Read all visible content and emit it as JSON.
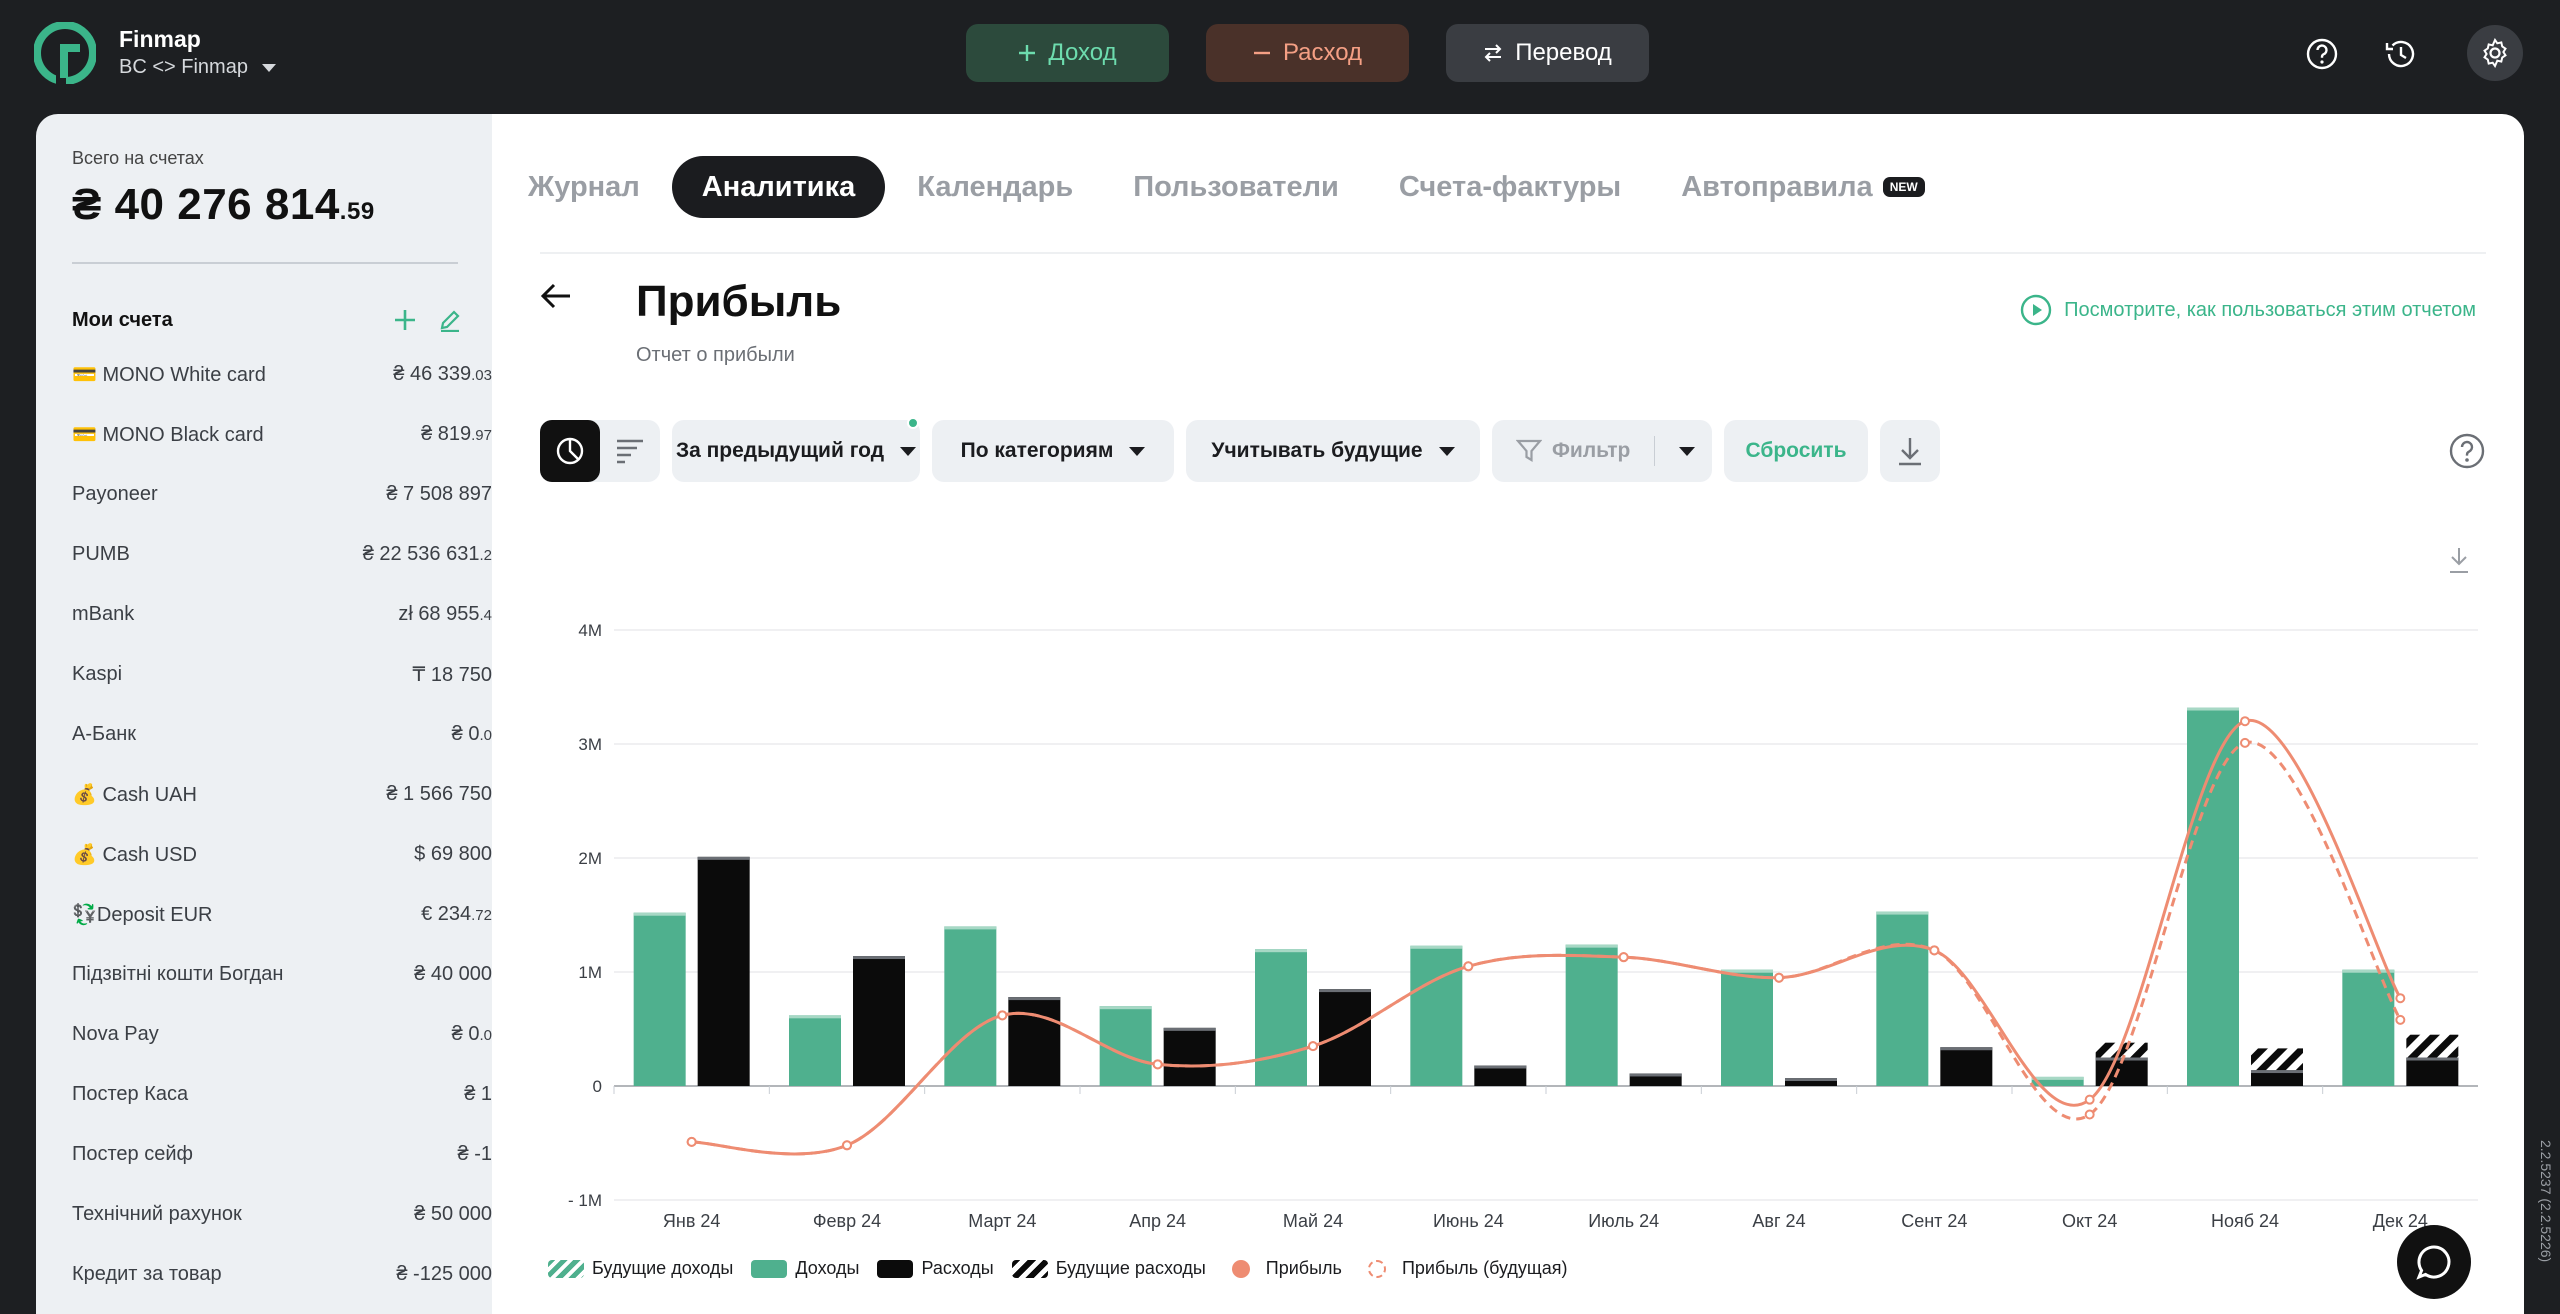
{
  "app": {
    "name": "Finmap",
    "workspace": "BC <> Finmap"
  },
  "topbar": {
    "income_label": "Доход",
    "expense_label": "Расход",
    "transfer_label": "Перевод"
  },
  "sidebar": {
    "total_label": "Всего на счетах",
    "total_main": "₴ 40 276 814",
    "total_cents": ".59",
    "accounts_title": "Мои счета",
    "accounts": [
      {
        "name": "💳 MONO White card",
        "value": "₴ 46 339",
        "cents": ".03"
      },
      {
        "name": "💳 MONO Black card",
        "value": "₴ 819",
        "cents": ".97"
      },
      {
        "name": "Payoneer",
        "value": "₴ 7 508 897",
        "cents": ""
      },
      {
        "name": "PUMB",
        "value": "₴ 22 536 631",
        "cents": ".2"
      },
      {
        "name": "mBank",
        "value": "zł 68 955",
        "cents": ".4"
      },
      {
        "name": "Kaspi",
        "value": "₸ 18 750",
        "cents": ""
      },
      {
        "name": "А-Банк",
        "value": "₴ 0",
        "cents": ".0"
      },
      {
        "name": "💰 Cash UAH",
        "value": "₴ 1 566 750",
        "cents": ""
      },
      {
        "name": "💰 Cash USD",
        "value": "$  69 800",
        "cents": ""
      },
      {
        "name": "💱Deposit EUR",
        "value": "€ 234",
        "cents": ".72"
      },
      {
        "name": "Підзвітні кошти Богдан",
        "value": "₴ 40 000",
        "cents": ""
      },
      {
        "name": "Nova Pay",
        "value": "₴ 0",
        "cents": ".0"
      },
      {
        "name": "Постер Каса",
        "value": "₴ 1",
        "cents": ""
      },
      {
        "name": "Постер сейф",
        "value": "₴ -1",
        "cents": ""
      },
      {
        "name": "Технічний рахунок",
        "value": "₴ 50 000",
        "cents": ""
      },
      {
        "name": "Кредит за товар",
        "value": "₴ -125 000",
        "cents": ""
      }
    ]
  },
  "tabs": [
    {
      "label": "Журнал",
      "active": false
    },
    {
      "label": "Аналитика",
      "active": true
    },
    {
      "label": "Календарь",
      "active": false
    },
    {
      "label": "Пользователи",
      "active": false
    },
    {
      "label": "Счета-фактуры",
      "active": false
    },
    {
      "label": "Автоправила",
      "active": false,
      "badge": "NEW"
    }
  ],
  "page": {
    "title": "Прибыль",
    "subtitle": "Отчет о прибыли",
    "howto": "Посмотрите, как пользоваться этим отчетом"
  },
  "filters": {
    "period": "За предыдущий год",
    "grouping": "По категориям",
    "future": "Учитывать будущие",
    "filter": "Фильтр",
    "reset": "Сбросить"
  },
  "colors": {
    "income": "#4fb08e",
    "expense": "#0b0b0b",
    "profit": "#ee8c72",
    "accent": "#3bb58a"
  },
  "chart_data": {
    "type": "bar",
    "categories": [
      "Янв 24",
      "Февр 24",
      "Март 24",
      "Апр 24",
      "Май 24",
      "Июнь 24",
      "Июль 24",
      "Авг 24",
      "Сент 24",
      "Окт 24",
      "Нояб 24",
      "Дек 24"
    ],
    "y_ticks": [
      "4M",
      "3M",
      "2M",
      "1M",
      "0",
      "- 1M"
    ],
    "ylim": [
      -1000000,
      4000000
    ],
    "series": [
      {
        "name": "Доходы",
        "type": "bar",
        "values": [
          1520000,
          620000,
          1400000,
          700000,
          1200000,
          1230000,
          1240000,
          1020000,
          1530000,
          80000,
          3320000,
          1020000
        ]
      },
      {
        "name": "Расходы",
        "type": "bar",
        "values": [
          2010000,
          1140000,
          780000,
          510000,
          850000,
          180000,
          110000,
          70000,
          340000,
          250000,
          140000,
          250000
        ]
      },
      {
        "name": "Будущие расходы",
        "type": "bar",
        "values": [
          0,
          0,
          0,
          0,
          0,
          0,
          0,
          0,
          0,
          130000,
          190000,
          200000
        ]
      },
      {
        "name": "Прибыль",
        "type": "line",
        "values": [
          -490000,
          -520000,
          620000,
          190000,
          350000,
          1050000,
          1130000,
          950000,
          1190000,
          -120000,
          3200000,
          770000
        ]
      },
      {
        "name": "Прибыль (будущая)",
        "type": "line",
        "values": [
          -490000,
          -520000,
          620000,
          190000,
          350000,
          1050000,
          1130000,
          950000,
          1190000,
          -250000,
          3010000,
          580000
        ]
      }
    ],
    "legend": [
      "Будущие доходы",
      "Доходы",
      "Расходы",
      "Будущие расходы",
      "Прибыль",
      "Прибыль (будущая)"
    ]
  },
  "version": "2.2.5237 (2.2.5226)"
}
